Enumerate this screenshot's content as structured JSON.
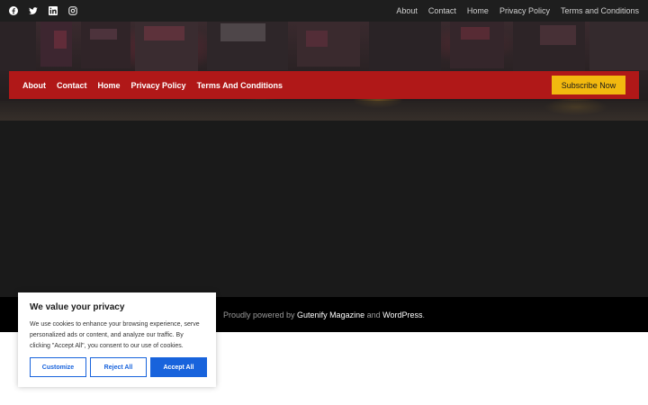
{
  "topbar": {
    "social_icons": [
      "facebook-icon",
      "twitter-icon",
      "linkedin-icon",
      "instagram-icon"
    ],
    "nav": [
      "About",
      "Contact",
      "Home",
      "Privacy Policy",
      "Terms and Conditions"
    ]
  },
  "header": {
    "nav": [
      "About",
      "Contact",
      "Home",
      "Privacy Policy",
      "Terms And Conditions"
    ],
    "subscribe_label": "Subscribe Now",
    "accent_color": "#b01818",
    "subscribe_color": "#f2b90f"
  },
  "footer": {
    "prefix": "Proudly powered by ",
    "theme_link": "Gutenify Magazine",
    "conjunction": " and ",
    "wp_link": "WordPress",
    "suffix": "."
  },
  "cookie": {
    "title": "We value your privacy",
    "message": "We use cookies to enhance your browsing experience, serve personalized ads or content, and analyze our traffic. By clicking \"Accept All\", you consent to our use of cookies.",
    "customize_label": "Customize",
    "reject_label": "Reject All",
    "accept_label": "Accept All",
    "button_color": "#1863dc"
  }
}
